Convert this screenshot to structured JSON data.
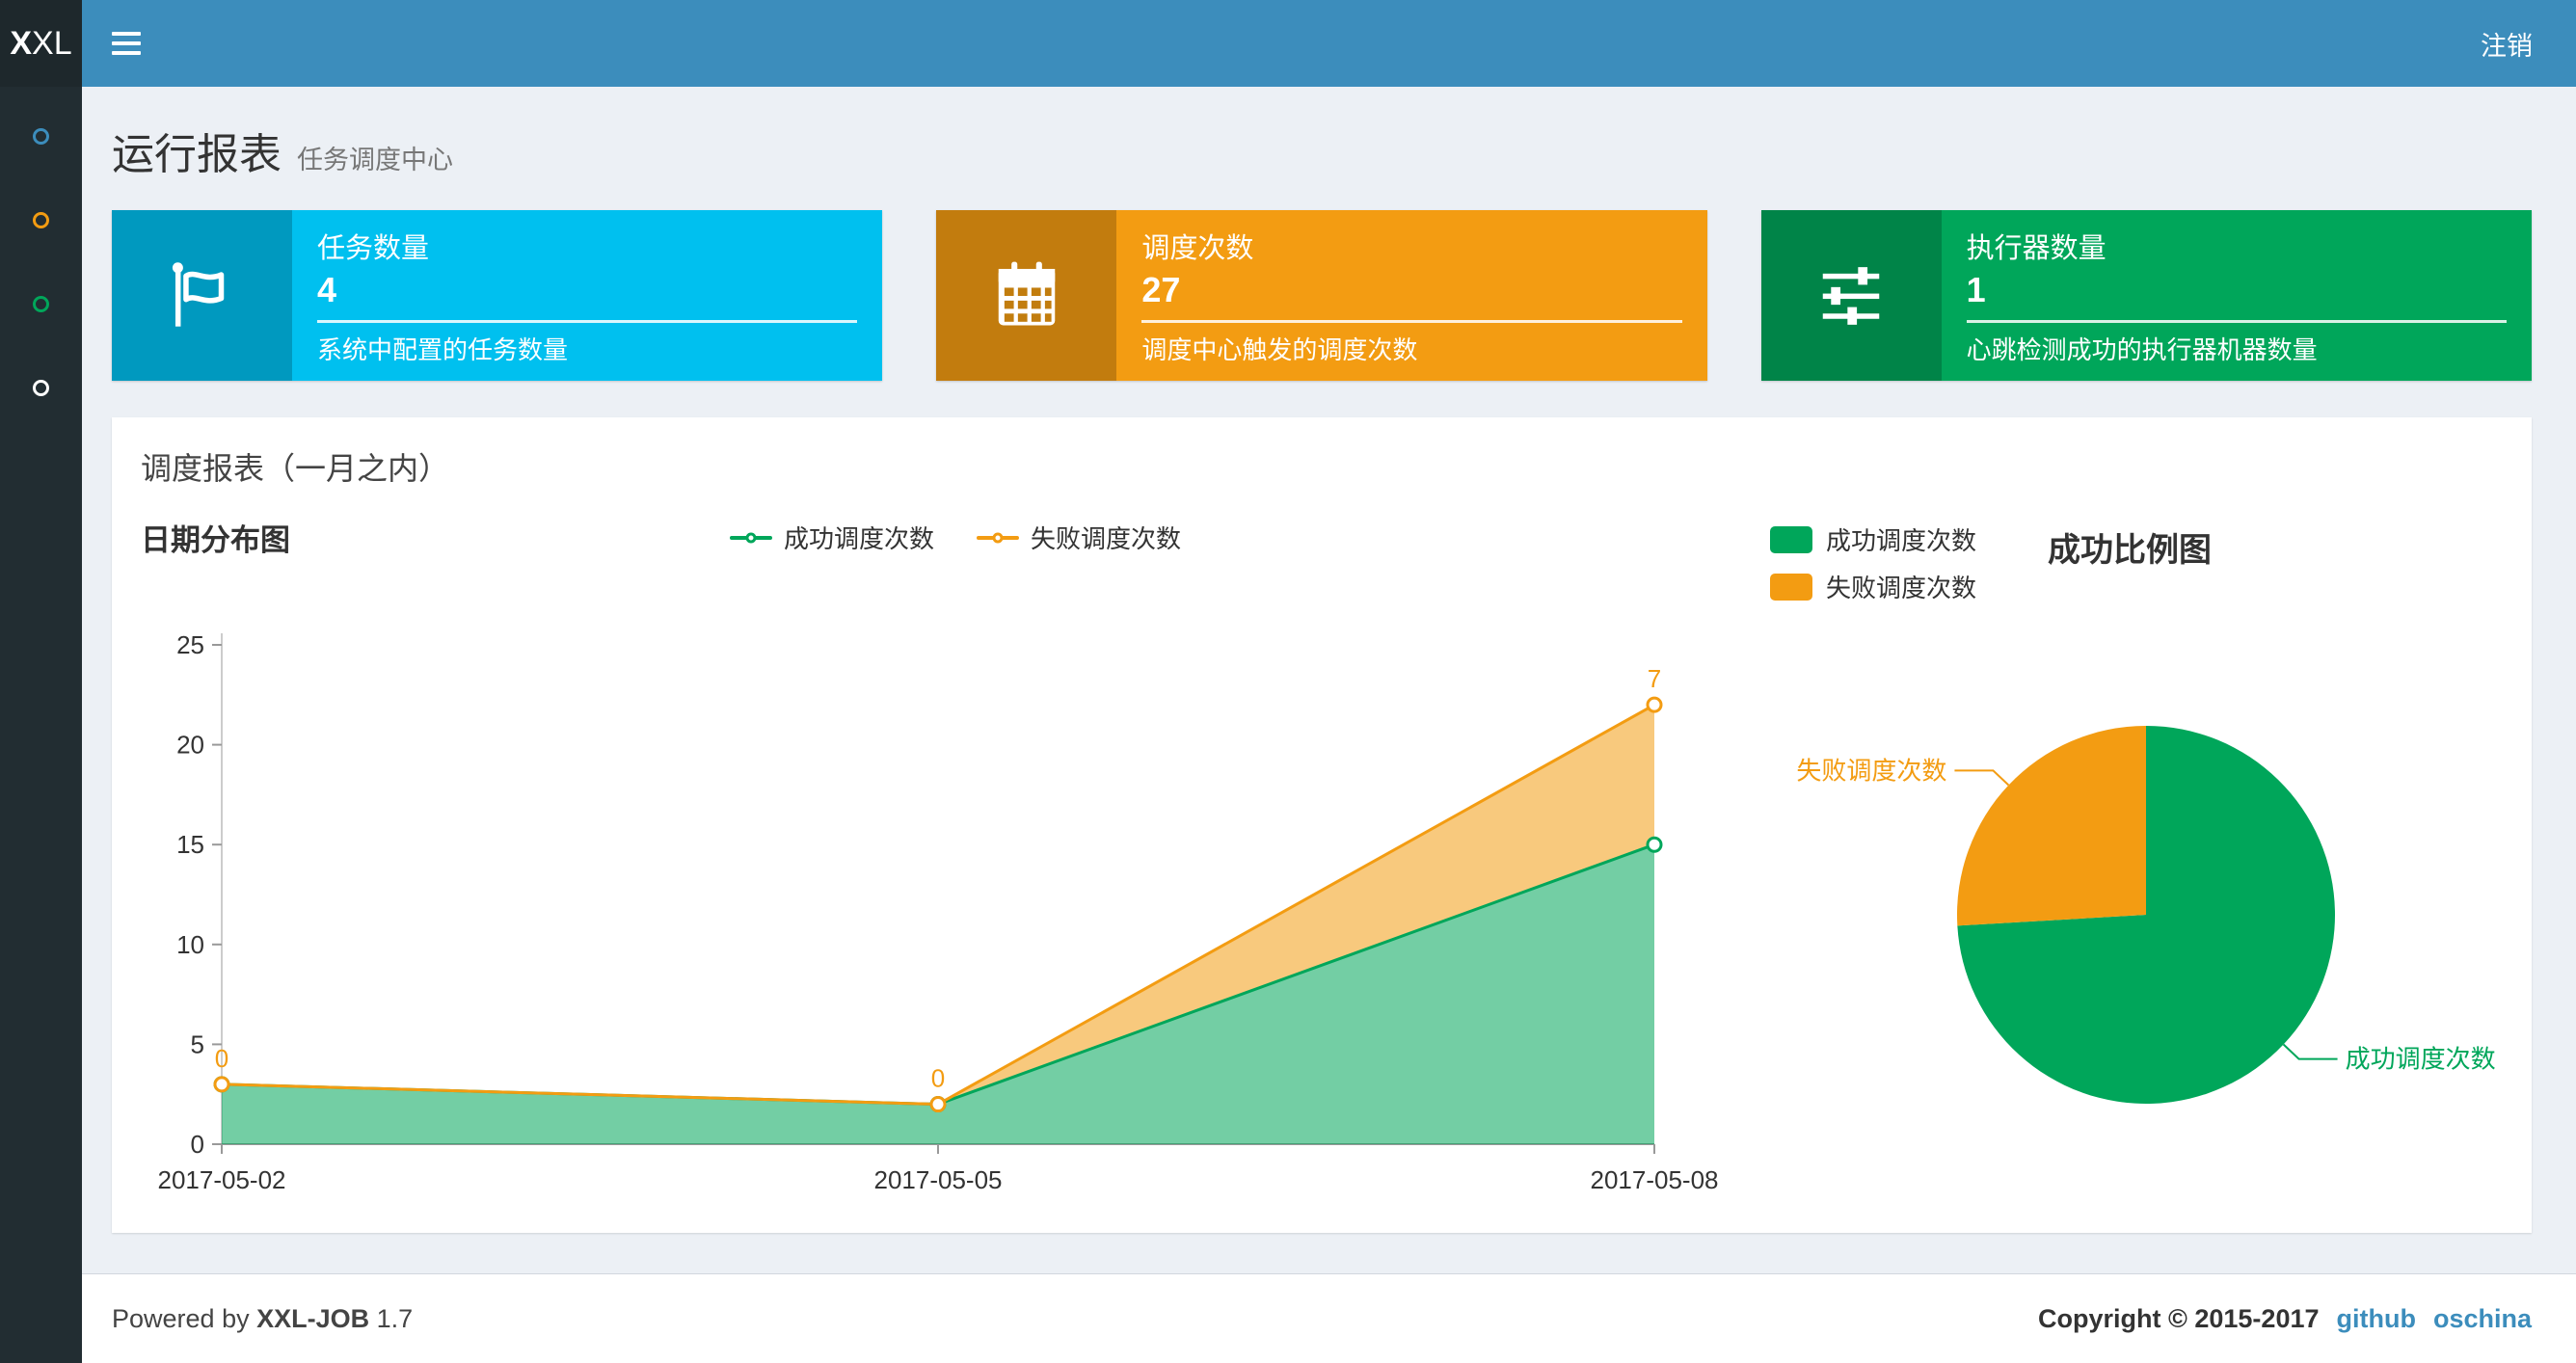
{
  "navbar": {
    "logo_bold": "X",
    "logo_rest": "XL",
    "logout": "注销"
  },
  "sidebar": {
    "items": [
      {
        "name": "nav-dot-blue",
        "color": "#3c8dbc"
      },
      {
        "name": "nav-dot-orange",
        "color": "#f39c12"
      },
      {
        "name": "nav-dot-green",
        "color": "#00a65a"
      },
      {
        "name": "nav-dot-white",
        "color": "#ffffff"
      }
    ]
  },
  "header": {
    "title": "运行报表",
    "subtitle": "任务调度中心"
  },
  "info_boxes": [
    {
      "label": "任务数量",
      "value": "4",
      "desc": "系统中配置的任务数量",
      "bg": "#00c0ef",
      "icon": "flag-icon"
    },
    {
      "label": "调度次数",
      "value": "27",
      "desc": "调度中心触发的调度次数",
      "bg": "#f39c12",
      "icon": "calendar-icon"
    },
    {
      "label": "执行器数量",
      "value": "1",
      "desc": "心跳检测成功的执行器机器数量",
      "bg": "#00a65a",
      "icon": "sliders-icon"
    }
  ],
  "panel": {
    "title": "调度报表（一月之内）"
  },
  "chart_data": [
    {
      "type": "area",
      "title": "日期分布图",
      "x": [
        "2017-05-02",
        "2017-05-05",
        "2017-05-08"
      ],
      "series": [
        {
          "name": "成功调度次数",
          "values": [
            3,
            2,
            15
          ],
          "color": "#00a65a",
          "fill": "rgba(0,166,90,0.55)"
        },
        {
          "name": "失败调度次数",
          "values": [
            0,
            0,
            7
          ],
          "color": "#f39c12",
          "fill": "rgba(243,156,18,0.55)",
          "stacked_on": "成功调度次数",
          "point_labels": [
            "0",
            "0",
            "7"
          ]
        }
      ],
      "ylim": [
        0,
        25
      ],
      "ytick_step": 5,
      "grid": false,
      "legend_position": "top-center"
    },
    {
      "type": "pie",
      "title": "成功比例图",
      "slices": [
        {
          "name": "成功调度次数",
          "value": 20,
          "color": "#00a65a"
        },
        {
          "name": "失败调度次数",
          "value": 7,
          "color": "#f39c12"
        }
      ],
      "start_angle": 90,
      "direction": "clockwise",
      "legend_position": "top-left"
    }
  ],
  "footer": {
    "powered_prefix": "Powered by",
    "product": "XXL-JOB",
    "version": "1.7",
    "copyright": "Copyright © 2015-2017",
    "links": [
      "github",
      "oschina"
    ],
    "link_color": "#3c8dbc"
  }
}
